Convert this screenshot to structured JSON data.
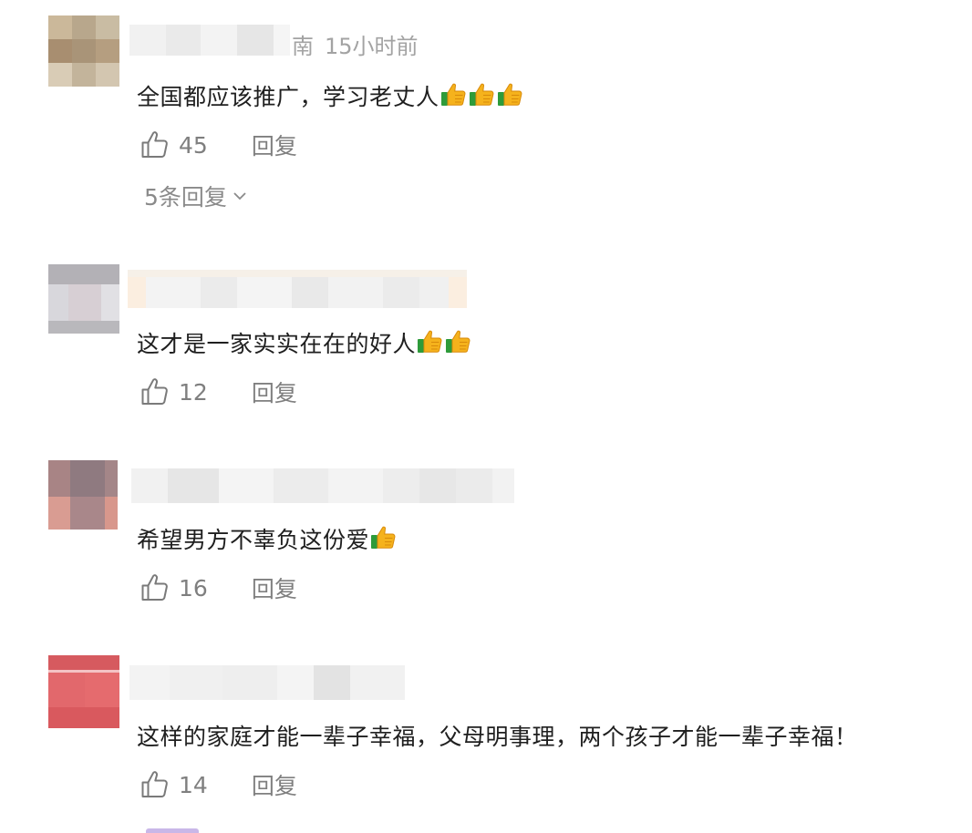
{
  "comments": [
    {
      "location": "南",
      "time": "15小时前",
      "text": "全国都应该推广，学习老丈人",
      "emoji_count": 3,
      "likes": "45",
      "reply_label": "回复",
      "replies_label": "5条回复"
    },
    {
      "text": "这才是一家实实在在的好人",
      "emoji_count": 2,
      "likes": "12",
      "reply_label": "回复"
    },
    {
      "text": "希望男方不辜负这份爱",
      "emoji_count": 1,
      "likes": "16",
      "reply_label": "回复"
    },
    {
      "text": "这样的家庭才能一辈子幸福，父母明事理，两个孩子才能一辈子幸福！",
      "emoji_count": 0,
      "likes": "14",
      "reply_label": "回复"
    }
  ],
  "icons": {
    "like": "thumbs-up-outline-icon",
    "emoji": "thumbs-up-emoji-icon",
    "expand": "chevron-down-icon"
  },
  "colors": {
    "meta_text": "#a3a3a3",
    "action_text": "#7f7f7f",
    "body_text": "#1f1f1f"
  }
}
